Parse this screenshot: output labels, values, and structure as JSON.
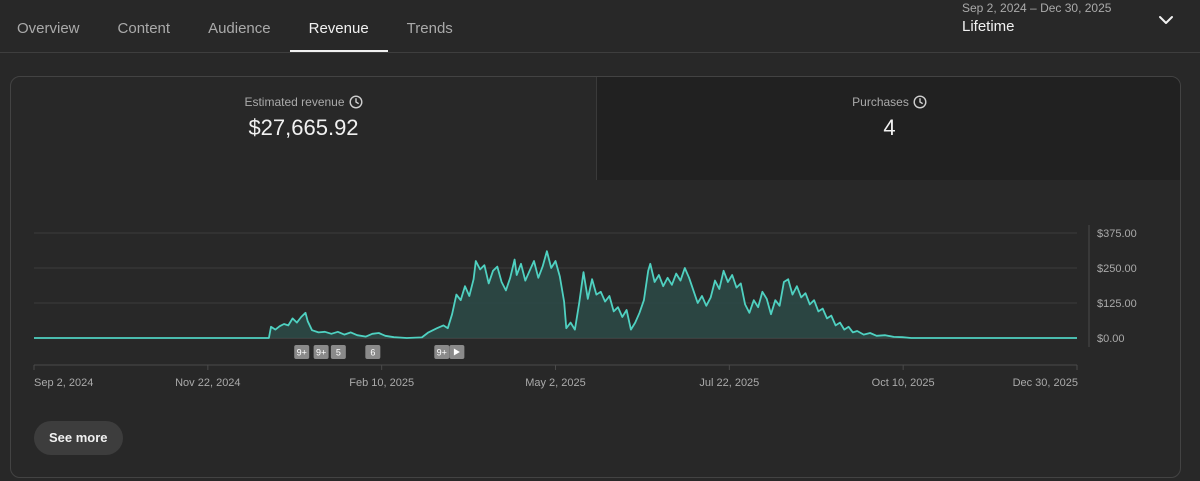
{
  "tabs": [
    {
      "label": "Overview",
      "active": false
    },
    {
      "label": "Content",
      "active": false
    },
    {
      "label": "Audience",
      "active": false
    },
    {
      "label": "Revenue",
      "active": true
    },
    {
      "label": "Trends",
      "active": false
    }
  ],
  "date_range": {
    "range": "Sep 2, 2024 – Dec 30, 2025",
    "preset": "Lifetime",
    "icon": "chevron-down-icon"
  },
  "metrics": [
    {
      "label": "Estimated revenue",
      "value": "$27,665.92",
      "icon": "clock-icon",
      "selected": true
    },
    {
      "label": "Purchases",
      "value": "4",
      "icon": "clock-icon",
      "selected": false
    }
  ],
  "see_more_label": "See more",
  "colors": {
    "line": "#4fd1c1",
    "fill": "#2c4a46",
    "grid": "#3c3c3c",
    "axis_text": "#aaaaaa"
  },
  "chart_data": {
    "type": "area",
    "title": "",
    "xlabel": "",
    "ylabel": "",
    "x_tick_labels": [
      "Sep 2, 2024",
      "Nov 22, 2024",
      "Feb 10, 2025",
      "May 2, 2025",
      "Jul 22, 2025",
      "Oct 10, 2025",
      "Dec 30, 2025"
    ],
    "y_tick_values": [
      0,
      125,
      250,
      375
    ],
    "y_tick_labels": [
      "$0.00",
      "$125.00",
      "$250.00",
      "$375.00"
    ],
    "xlim": [
      "2024-09-02",
      "2025-12-30"
    ],
    "ylim": [
      0,
      375
    ],
    "grid": true,
    "series": [
      {
        "points": [
          [
            "2024-09-02",
            0
          ],
          [
            "2024-12-20",
            0
          ],
          [
            "2024-12-21",
            40
          ],
          [
            "2024-12-23",
            30
          ],
          [
            "2024-12-25",
            42
          ],
          [
            "2024-12-27",
            50
          ],
          [
            "2024-12-29",
            45
          ],
          [
            "2024-12-31",
            70
          ],
          [
            "2025-01-02",
            55
          ],
          [
            "2025-01-04",
            75
          ],
          [
            "2025-01-06",
            90
          ],
          [
            "2025-01-07",
            60
          ],
          [
            "2025-01-09",
            28
          ],
          [
            "2025-01-12",
            20
          ],
          [
            "2025-01-15",
            22
          ],
          [
            "2025-01-18",
            15
          ],
          [
            "2025-01-21",
            22
          ],
          [
            "2025-01-24",
            12
          ],
          [
            "2025-01-27",
            20
          ],
          [
            "2025-01-30",
            10
          ],
          [
            "2025-02-03",
            5
          ],
          [
            "2025-02-06",
            15
          ],
          [
            "2025-02-09",
            18
          ],
          [
            "2025-02-12",
            8
          ],
          [
            "2025-02-16",
            3
          ],
          [
            "2025-02-22",
            0
          ],
          [
            "2025-03-01",
            2
          ],
          [
            "2025-03-04",
            20
          ],
          [
            "2025-03-08",
            35
          ],
          [
            "2025-03-11",
            45
          ],
          [
            "2025-03-13",
            35
          ],
          [
            "2025-03-15",
            85
          ],
          [
            "2025-03-17",
            155
          ],
          [
            "2025-03-19",
            135
          ],
          [
            "2025-03-21",
            185
          ],
          [
            "2025-03-23",
            150
          ],
          [
            "2025-03-25",
            210
          ],
          [
            "2025-03-26",
            275
          ],
          [
            "2025-03-28",
            245
          ],
          [
            "2025-03-30",
            260
          ],
          [
            "2025-04-01",
            195
          ],
          [
            "2025-04-03",
            240
          ],
          [
            "2025-04-05",
            255
          ],
          [
            "2025-04-07",
            200
          ],
          [
            "2025-04-09",
            170
          ],
          [
            "2025-04-11",
            215
          ],
          [
            "2025-04-13",
            280
          ],
          [
            "2025-04-14",
            225
          ],
          [
            "2025-04-16",
            265
          ],
          [
            "2025-04-18",
            205
          ],
          [
            "2025-04-20",
            240
          ],
          [
            "2025-04-22",
            275
          ],
          [
            "2025-04-24",
            215
          ],
          [
            "2025-04-26",
            255
          ],
          [
            "2025-04-28",
            310
          ],
          [
            "2025-04-30",
            250
          ],
          [
            "2025-05-02",
            275
          ],
          [
            "2025-05-04",
            220
          ],
          [
            "2025-05-06",
            130
          ],
          [
            "2025-05-07",
            35
          ],
          [
            "2025-05-09",
            55
          ],
          [
            "2025-05-11",
            30
          ],
          [
            "2025-05-13",
            125
          ],
          [
            "2025-05-15",
            235
          ],
          [
            "2025-05-17",
            140
          ],
          [
            "2025-05-19",
            210
          ],
          [
            "2025-05-21",
            155
          ],
          [
            "2025-05-23",
            165
          ],
          [
            "2025-05-25",
            130
          ],
          [
            "2025-05-27",
            150
          ],
          [
            "2025-05-29",
            95
          ],
          [
            "2025-05-31",
            110
          ],
          [
            "2025-06-02",
            75
          ],
          [
            "2025-06-04",
            100
          ],
          [
            "2025-06-06",
            30
          ],
          [
            "2025-06-08",
            55
          ],
          [
            "2025-06-10",
            90
          ],
          [
            "2025-06-12",
            135
          ],
          [
            "2025-06-14",
            240
          ],
          [
            "2025-06-15",
            265
          ],
          [
            "2025-06-17",
            200
          ],
          [
            "2025-06-19",
            225
          ],
          [
            "2025-06-21",
            185
          ],
          [
            "2025-06-23",
            215
          ],
          [
            "2025-06-25",
            190
          ],
          [
            "2025-06-27",
            230
          ],
          [
            "2025-06-29",
            205
          ],
          [
            "2025-07-01",
            250
          ],
          [
            "2025-07-03",
            215
          ],
          [
            "2025-07-05",
            170
          ],
          [
            "2025-07-07",
            125
          ],
          [
            "2025-07-09",
            150
          ],
          [
            "2025-07-11",
            115
          ],
          [
            "2025-07-13",
            145
          ],
          [
            "2025-07-15",
            205
          ],
          [
            "2025-07-17",
            175
          ],
          [
            "2025-07-19",
            240
          ],
          [
            "2025-07-21",
            200
          ],
          [
            "2025-07-23",
            225
          ],
          [
            "2025-07-25",
            180
          ],
          [
            "2025-07-27",
            195
          ],
          [
            "2025-07-29",
            120
          ],
          [
            "2025-07-31",
            90
          ],
          [
            "2025-08-02",
            135
          ],
          [
            "2025-08-04",
            110
          ],
          [
            "2025-08-06",
            165
          ],
          [
            "2025-08-08",
            140
          ],
          [
            "2025-08-10",
            85
          ],
          [
            "2025-08-12",
            135
          ],
          [
            "2025-08-14",
            115
          ],
          [
            "2025-08-16",
            200
          ],
          [
            "2025-08-18",
            210
          ],
          [
            "2025-08-20",
            155
          ],
          [
            "2025-08-22",
            185
          ],
          [
            "2025-08-24",
            145
          ],
          [
            "2025-08-26",
            160
          ],
          [
            "2025-08-28",
            120
          ],
          [
            "2025-08-30",
            135
          ],
          [
            "2025-09-01",
            95
          ],
          [
            "2025-09-03",
            105
          ],
          [
            "2025-09-05",
            70
          ],
          [
            "2025-09-07",
            80
          ],
          [
            "2025-09-09",
            45
          ],
          [
            "2025-09-11",
            55
          ],
          [
            "2025-09-13",
            30
          ],
          [
            "2025-09-15",
            40
          ],
          [
            "2025-09-17",
            20
          ],
          [
            "2025-09-19",
            25
          ],
          [
            "2025-09-22",
            12
          ],
          [
            "2025-09-25",
            18
          ],
          [
            "2025-09-28",
            8
          ],
          [
            "2025-10-02",
            10
          ],
          [
            "2025-10-06",
            4
          ],
          [
            "2025-10-10",
            3
          ],
          [
            "2025-10-14",
            0
          ],
          [
            "2025-12-30",
            0
          ]
        ]
      }
    ],
    "annotations": [
      {
        "date": "2025-01-04",
        "label": "9+"
      },
      {
        "date": "2025-01-13",
        "label": "9+"
      },
      {
        "date": "2025-01-21",
        "label": "5"
      },
      {
        "date": "2025-02-06",
        "label": "6"
      },
      {
        "date": "2025-03-10",
        "label": "9+"
      },
      {
        "date": "2025-03-17",
        "label": "",
        "icon": "play-icon"
      }
    ]
  }
}
